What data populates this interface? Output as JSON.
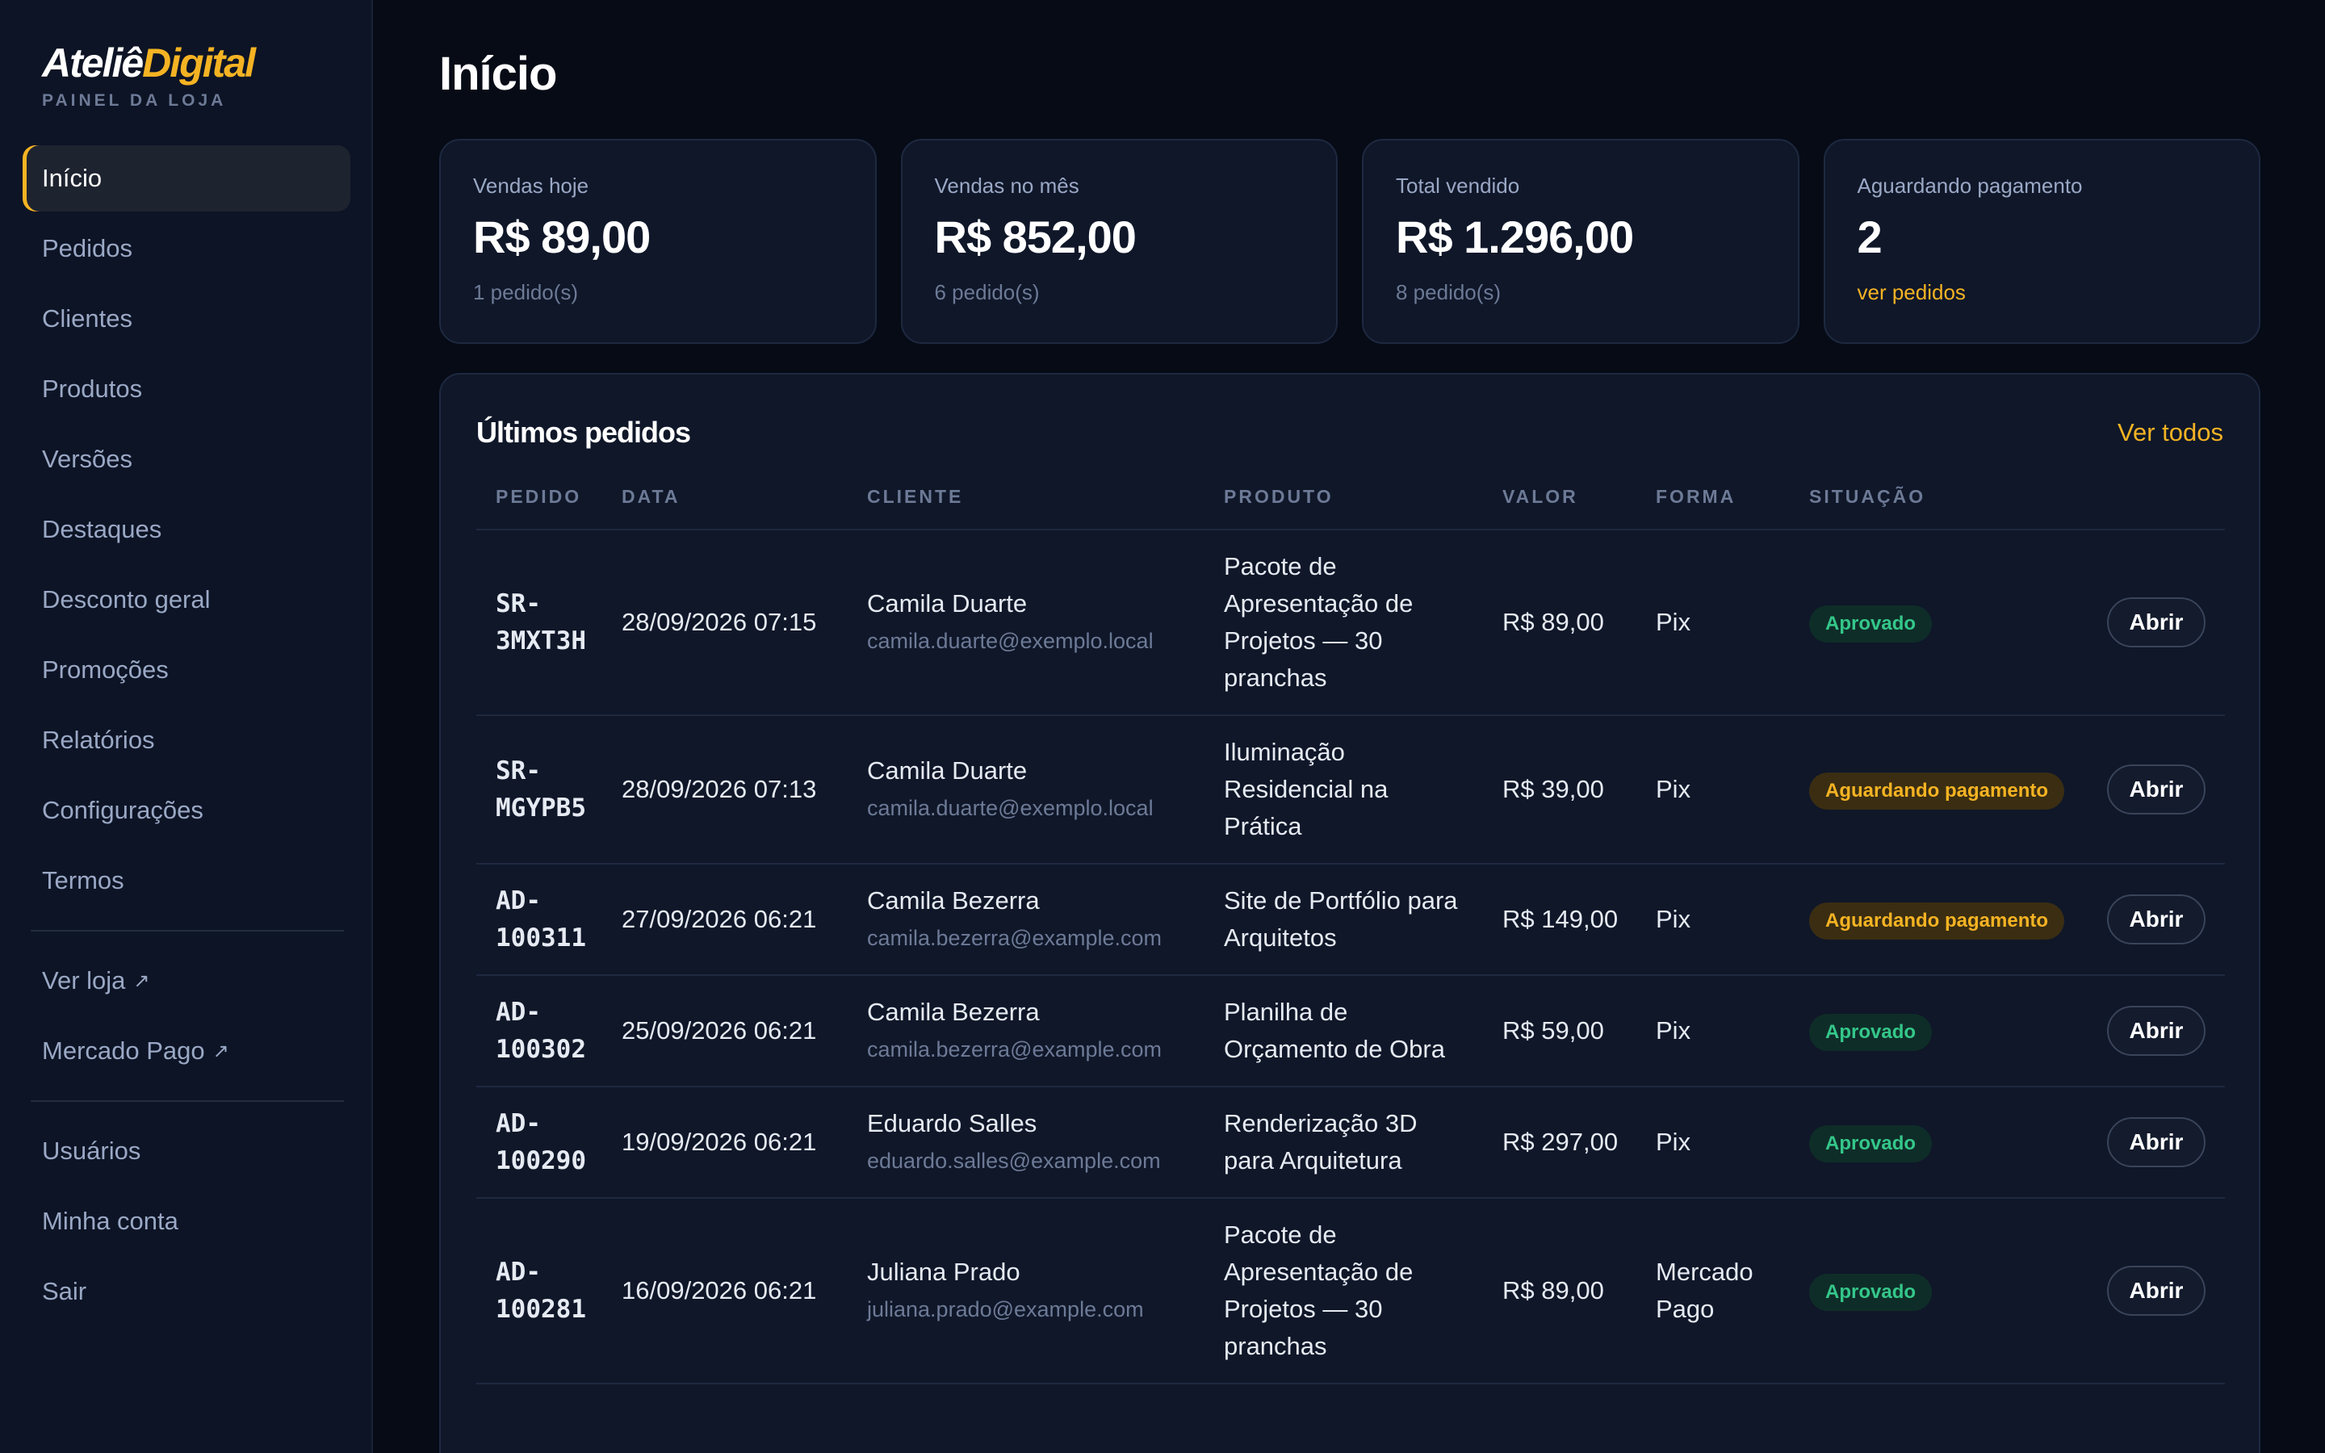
{
  "brand": {
    "name_part1": "Ateliê",
    "name_part2": "Digital",
    "subtitle": "PAINEL DA LOJA"
  },
  "sidebar": {
    "items": [
      {
        "label": "Início",
        "active": true
      },
      {
        "label": "Pedidos"
      },
      {
        "label": "Clientes"
      },
      {
        "label": "Produtos"
      },
      {
        "label": "Versões"
      },
      {
        "label": "Destaques"
      },
      {
        "label": "Desconto geral"
      },
      {
        "label": "Promoções"
      },
      {
        "label": "Relatórios"
      },
      {
        "label": "Configurações"
      },
      {
        "label": "Termos"
      }
    ],
    "external": [
      {
        "label": "Ver loja",
        "icon": "external-link-icon",
        "glyph": "↗"
      },
      {
        "label": "Mercado Pago",
        "icon": "external-link-icon",
        "glyph": "↗"
      }
    ],
    "account": [
      {
        "label": "Usuários"
      },
      {
        "label": "Minha conta"
      },
      {
        "label": "Sair"
      }
    ]
  },
  "page": {
    "title": "Início"
  },
  "stats": [
    {
      "label": "Vendas hoje",
      "value": "R$ 89,00",
      "sub": "1 pedido(s)"
    },
    {
      "label": "Vendas no mês",
      "value": "R$ 852,00",
      "sub": "6 pedido(s)"
    },
    {
      "label": "Total vendido",
      "value": "R$ 1.296,00",
      "sub": "8 pedido(s)"
    },
    {
      "label": "Aguardando pagamento",
      "value": "2",
      "sub": "ver pedidos"
    }
  ],
  "orders": {
    "title": "Últimos pedidos",
    "view_all": "Ver todos",
    "columns": [
      "PEDIDO",
      "DATA",
      "CLIENTE",
      "PRODUTO",
      "VALOR",
      "FORMA",
      "SITUAÇÃO"
    ],
    "rows": [
      {
        "id": "SR-3MXT3H",
        "date": "28/09/2026 07:15",
        "name": "Camila Duarte",
        "email": "camila.duarte@exemplo.local",
        "product": "Pacote de Apresentação de Projetos — 30 pranchas",
        "value": "R$ 89,00",
        "method": "Pix",
        "status": "Aprovado",
        "action": "Abrir"
      },
      {
        "id": "SR-MGYPB5",
        "date": "28/09/2026 07:13",
        "name": "Camila Duarte",
        "email": "camila.duarte@exemplo.local",
        "product": "Iluminação Residencial na Prática",
        "value": "R$ 39,00",
        "method": "Pix",
        "status": "Aguardando pagamento",
        "action": "Abrir"
      },
      {
        "id": "AD-100311",
        "date": "27/09/2026 06:21",
        "name": "Camila Bezerra",
        "email": "camila.bezerra@example.com",
        "product": "Site de Portfólio para Arquitetos",
        "value": "R$ 149,00",
        "method": "Pix",
        "status": "Aguardando pagamento",
        "action": "Abrir"
      },
      {
        "id": "AD-100302",
        "date": "25/09/2026 06:21",
        "name": "Camila Bezerra",
        "email": "camila.bezerra@example.com",
        "product": "Planilha de Orçamento de Obra",
        "value": "R$ 59,00",
        "method": "Pix",
        "status": "Aprovado",
        "action": "Abrir"
      },
      {
        "id": "AD-100290",
        "date": "19/09/2026 06:21",
        "name": "Eduardo Salles",
        "email": "eduardo.salles@example.com",
        "product": "Renderização 3D para Arquitetura",
        "value": "R$ 297,00",
        "method": "Pix",
        "status": "Aprovado",
        "action": "Abrir"
      },
      {
        "id": "AD-100281",
        "date": "16/09/2026 06:21",
        "name": "Juliana Prado",
        "email": "juliana.prado@example.com",
        "product": "Pacote de Apresentação de Projetos — 30 pranchas",
        "value": "R$ 89,00",
        "method": "Mercado Pago",
        "status": "Aprovado",
        "action": "Abrir"
      }
    ]
  },
  "colors": {
    "accent": "#f5b323",
    "approved": "#34c78a",
    "background": "#060b16",
    "card": "#0f1729",
    "sidebar": "#0d1425"
  }
}
